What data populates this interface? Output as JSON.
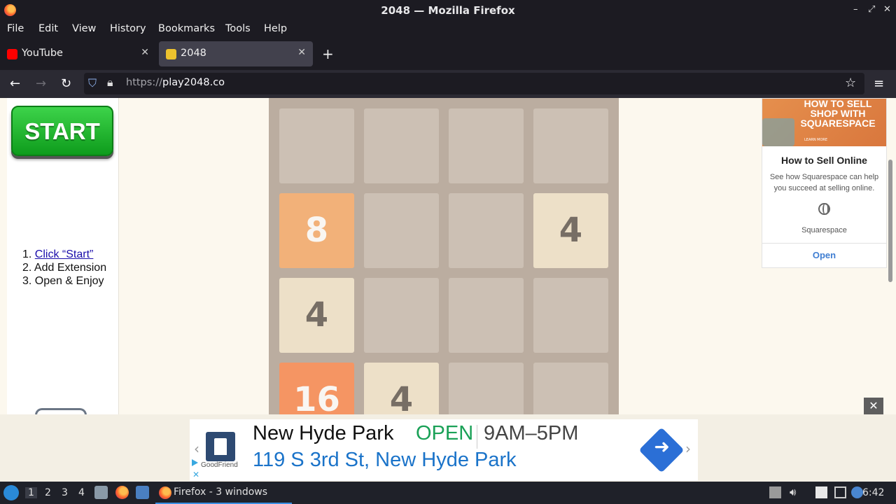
{
  "window": {
    "title": "2048 — Mozilla Firefox",
    "controls": [
      "–",
      "⤢",
      "✕"
    ]
  },
  "menu": [
    "File",
    "Edit",
    "View",
    "History",
    "Bookmarks",
    "Tools",
    "Help"
  ],
  "tabs": [
    {
      "label": "YouTube",
      "favicon_color": "#ff0000",
      "active": false
    },
    {
      "label": "2048",
      "favicon_color": "#edc22e",
      "active": true
    }
  ],
  "new_tab_label": "+",
  "nav": {
    "url_scheme": "https://",
    "url_host": "play2048.co"
  },
  "left_panel": {
    "start_label": "START",
    "steps": [
      "1. ",
      "Click “Start”",
      "2. Add Extension",
      "3. Open & Enjoy"
    ]
  },
  "board": {
    "rows": [
      [
        "",
        "",
        "",
        ""
      ],
      [
        "8",
        "",
        "",
        "4"
      ],
      [
        "4",
        "",
        "",
        ""
      ],
      [
        "16",
        "4",
        "",
        ""
      ]
    ]
  },
  "right_ad": {
    "banner_text": "HOW TO SELL SHOP WITH SQUARESPACE",
    "banner_small": "LEARN MORE",
    "heading": "How to Sell Online",
    "body": "See how Squarespace can help you succeed at selling online.",
    "advertiser": "Squarespace",
    "cta": "Open"
  },
  "bottom_ad": {
    "close": "✕",
    "brand": "GoodFriend",
    "name": "New Hyde Park",
    "status": "OPEN",
    "hours": "9AM–5PM",
    "address": "119 S 3rd St, New Hyde Park",
    "status_color": "#1aa157",
    "address_color": "#1a73c9"
  },
  "taskbar": {
    "workspaces": [
      "1",
      "2",
      "3",
      "4"
    ],
    "active_workspace": "1",
    "window_button": "Firefox - 3 windows",
    "clock": "6:42"
  }
}
